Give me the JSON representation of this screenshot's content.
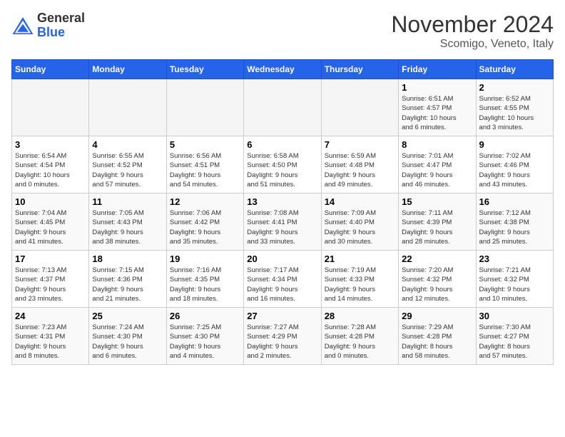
{
  "header": {
    "logo_line1": "General",
    "logo_line2": "Blue",
    "month": "November 2024",
    "location": "Scomigo, Veneto, Italy"
  },
  "weekdays": [
    "Sunday",
    "Monday",
    "Tuesday",
    "Wednesday",
    "Thursday",
    "Friday",
    "Saturday"
  ],
  "weeks": [
    [
      {
        "day": "",
        "info": ""
      },
      {
        "day": "",
        "info": ""
      },
      {
        "day": "",
        "info": ""
      },
      {
        "day": "",
        "info": ""
      },
      {
        "day": "",
        "info": ""
      },
      {
        "day": "1",
        "info": "Sunrise: 6:51 AM\nSunset: 4:57 PM\nDaylight: 10 hours\nand 6 minutes."
      },
      {
        "day": "2",
        "info": "Sunrise: 6:52 AM\nSunset: 4:55 PM\nDaylight: 10 hours\nand 3 minutes."
      }
    ],
    [
      {
        "day": "3",
        "info": "Sunrise: 6:54 AM\nSunset: 4:54 PM\nDaylight: 10 hours\nand 0 minutes."
      },
      {
        "day": "4",
        "info": "Sunrise: 6:55 AM\nSunset: 4:52 PM\nDaylight: 9 hours\nand 57 minutes."
      },
      {
        "day": "5",
        "info": "Sunrise: 6:56 AM\nSunset: 4:51 PM\nDaylight: 9 hours\nand 54 minutes."
      },
      {
        "day": "6",
        "info": "Sunrise: 6:58 AM\nSunset: 4:50 PM\nDaylight: 9 hours\nand 51 minutes."
      },
      {
        "day": "7",
        "info": "Sunrise: 6:59 AM\nSunset: 4:48 PM\nDaylight: 9 hours\nand 49 minutes."
      },
      {
        "day": "8",
        "info": "Sunrise: 7:01 AM\nSunset: 4:47 PM\nDaylight: 9 hours\nand 46 minutes."
      },
      {
        "day": "9",
        "info": "Sunrise: 7:02 AM\nSunset: 4:46 PM\nDaylight: 9 hours\nand 43 minutes."
      }
    ],
    [
      {
        "day": "10",
        "info": "Sunrise: 7:04 AM\nSunset: 4:45 PM\nDaylight: 9 hours\nand 41 minutes."
      },
      {
        "day": "11",
        "info": "Sunrise: 7:05 AM\nSunset: 4:43 PM\nDaylight: 9 hours\nand 38 minutes."
      },
      {
        "day": "12",
        "info": "Sunrise: 7:06 AM\nSunset: 4:42 PM\nDaylight: 9 hours\nand 35 minutes."
      },
      {
        "day": "13",
        "info": "Sunrise: 7:08 AM\nSunset: 4:41 PM\nDaylight: 9 hours\nand 33 minutes."
      },
      {
        "day": "14",
        "info": "Sunrise: 7:09 AM\nSunset: 4:40 PM\nDaylight: 9 hours\nand 30 minutes."
      },
      {
        "day": "15",
        "info": "Sunrise: 7:11 AM\nSunset: 4:39 PM\nDaylight: 9 hours\nand 28 minutes."
      },
      {
        "day": "16",
        "info": "Sunrise: 7:12 AM\nSunset: 4:38 PM\nDaylight: 9 hours\nand 25 minutes."
      }
    ],
    [
      {
        "day": "17",
        "info": "Sunrise: 7:13 AM\nSunset: 4:37 PM\nDaylight: 9 hours\nand 23 minutes."
      },
      {
        "day": "18",
        "info": "Sunrise: 7:15 AM\nSunset: 4:36 PM\nDaylight: 9 hours\nand 21 minutes."
      },
      {
        "day": "19",
        "info": "Sunrise: 7:16 AM\nSunset: 4:35 PM\nDaylight: 9 hours\nand 18 minutes."
      },
      {
        "day": "20",
        "info": "Sunrise: 7:17 AM\nSunset: 4:34 PM\nDaylight: 9 hours\nand 16 minutes."
      },
      {
        "day": "21",
        "info": "Sunrise: 7:19 AM\nSunset: 4:33 PM\nDaylight: 9 hours\nand 14 minutes."
      },
      {
        "day": "22",
        "info": "Sunrise: 7:20 AM\nSunset: 4:32 PM\nDaylight: 9 hours\nand 12 minutes."
      },
      {
        "day": "23",
        "info": "Sunrise: 7:21 AM\nSunset: 4:32 PM\nDaylight: 9 hours\nand 10 minutes."
      }
    ],
    [
      {
        "day": "24",
        "info": "Sunrise: 7:23 AM\nSunset: 4:31 PM\nDaylight: 9 hours\nand 8 minutes."
      },
      {
        "day": "25",
        "info": "Sunrise: 7:24 AM\nSunset: 4:30 PM\nDaylight: 9 hours\nand 6 minutes."
      },
      {
        "day": "26",
        "info": "Sunrise: 7:25 AM\nSunset: 4:30 PM\nDaylight: 9 hours\nand 4 minutes."
      },
      {
        "day": "27",
        "info": "Sunrise: 7:27 AM\nSunset: 4:29 PM\nDaylight: 9 hours\nand 2 minutes."
      },
      {
        "day": "28",
        "info": "Sunrise: 7:28 AM\nSunset: 4:28 PM\nDaylight: 9 hours\nand 0 minutes."
      },
      {
        "day": "29",
        "info": "Sunrise: 7:29 AM\nSunset: 4:28 PM\nDaylight: 8 hours\nand 58 minutes."
      },
      {
        "day": "30",
        "info": "Sunrise: 7:30 AM\nSunset: 4:27 PM\nDaylight: 8 hours\nand 57 minutes."
      }
    ]
  ]
}
